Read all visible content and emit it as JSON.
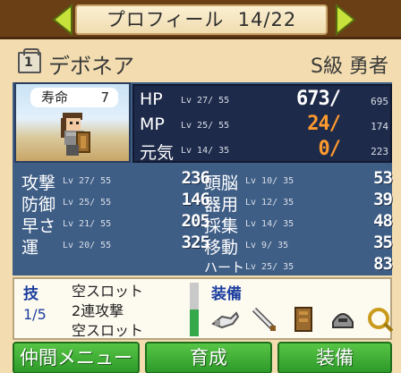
{
  "header": {
    "title": "プロフィール",
    "page": "14/22",
    "prev_icon": "left-arrow-icon",
    "next_icon": "right-arrow-icon"
  },
  "character": {
    "job_icon": "job-badge-icon",
    "job_icon_text": "1",
    "name": "デボネア",
    "rank": "S級 勇者",
    "lifespan_label": "寿命",
    "lifespan_value": "7"
  },
  "vitals": [
    {
      "name": "HP",
      "lv_text": "Lv 27/ 55",
      "value": "673/",
      "max": "695",
      "color": "#ffffff"
    },
    {
      "name": "MP",
      "lv_text": "Lv 25/ 55",
      "value": "24/",
      "max": "174",
      "color": "#ff9a2e"
    },
    {
      "name": "元気",
      "lv_text": "Lv 14/ 35",
      "value": "0/",
      "max": "223",
      "color": "#ff9a2e"
    }
  ],
  "stats_left": [
    {
      "name": "攻撃",
      "lv_text": "Lv 27/ 55",
      "value": "236"
    },
    {
      "name": "防御",
      "lv_text": "Lv 25/ 55",
      "value": "146"
    },
    {
      "name": "早さ",
      "lv_text": "Lv 21/ 55",
      "value": "205"
    },
    {
      "name": "運",
      "lv_text": "Lv 20/ 55",
      "value": "325"
    }
  ],
  "stats_right": [
    {
      "name": "頭脳",
      "lv_text": "Lv 10/ 35",
      "value": "53"
    },
    {
      "name": "器用",
      "lv_text": "Lv 12/ 35",
      "value": "39"
    },
    {
      "name": "採集",
      "lv_text": "Lv 14/ 35",
      "value": "48"
    },
    {
      "name": "移動",
      "lv_text": "Lv  9/ 35",
      "value": "35"
    },
    {
      "name": "ハート",
      "lv_text": "Lv 25/ 35",
      "value": "83"
    }
  ],
  "skills": {
    "label": "技",
    "count": "1/5",
    "items": [
      "空スロット",
      "2連攻撃",
      "空スロット"
    ],
    "gauge_fraction": 0.5
  },
  "equipment": {
    "label": "装備",
    "slots": [
      "weapon-glove-icon",
      "sword-icon",
      "armor-icon",
      "helmet-icon",
      "ring-icon"
    ]
  },
  "buttons": {
    "party_menu": "仲間メニュー",
    "train": "育成",
    "equip": "装備"
  },
  "colors": {
    "panel": "#3f5e86",
    "vitals_bg": "#1e2a4a",
    "accent_blue": "#1c3f9e",
    "button_green": "#3aae34",
    "header_brown": "#6b3f16"
  }
}
